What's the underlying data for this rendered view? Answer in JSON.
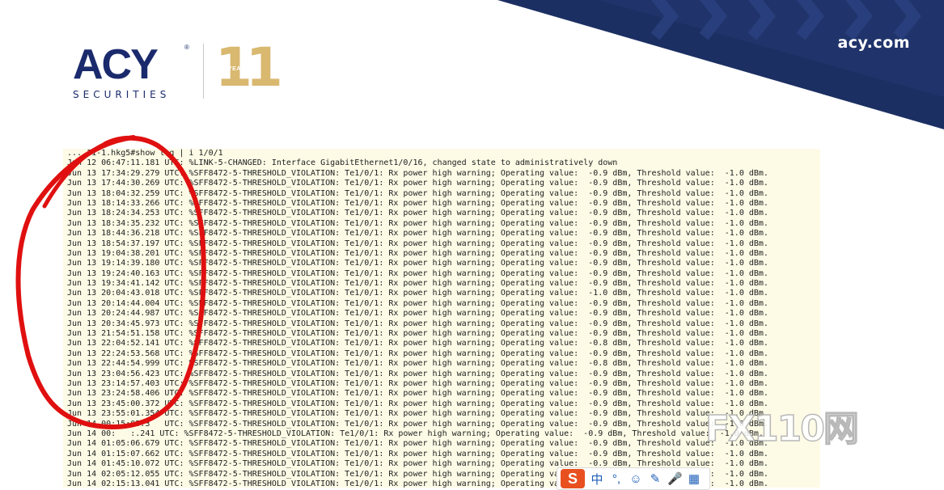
{
  "header": {
    "brand_url": "acy.com",
    "logo_text": "ACY",
    "logo_subtitle": "SECURITIES",
    "anniversary_number": "11",
    "anniversary_label": "YEARS",
    "colors": {
      "navy": "#1a2a6c",
      "gold": "#d9b870"
    }
  },
  "terminal": {
    "lines": [
      "... 11-1.hkg5#show log | i 1/0/1",
      "Jun 12 06:47:11.181 UTC: %LINK-5-CHANGED: Interface GigabitEthernet1/0/16, changed state to administratively down",
      "Jun 13 17:34:29.279 UTC: %SFF8472-5-THRESHOLD_VIOLATION: Te1/0/1: Rx power high warning; Operating value:  -0.9 dBm, Threshold value:  -1.0 dBm.",
      "Jun 13 17:44:30.269 UTC: %SFF8472-5-THRESHOLD_VIOLATION: Te1/0/1: Rx power high warning; Operating value:  -0.9 dBm, Threshold value:  -1.0 dBm.",
      "Jun 13 18:04:32.259 UTC: %SFF8472-5-THRESHOLD_VIOLATION: Te1/0/1: Rx power high warning; Operating value:  -0.9 dBm, Threshold value:  -1.0 dBm.",
      "Jun 13 18:14:33.266 UTC: %SFF8472-5-THRESHOLD_VIOLATION: Te1/0/1: Rx power high warning; Operating value:  -0.9 dBm, Threshold value:  -1.0 dBm.",
      "Jun 13 18:24:34.253 UTC: %SFF8472-5-THRESHOLD_VIOLATION: Te1/0/1: Rx power high warning; Operating value:  -0.9 dBm, Threshold value:  -1.0 dBm.",
      "Jun 13 18:34:35.232 UTC: %SFF8472-5-THRESHOLD_VIOLATION: Te1/0/1: Rx power high warning; Operating value:  -0.9 dBm, Threshold value:  -1.0 dBm.",
      "Jun 13 18:44:36.218 UTC: %SFF8472-5-THRESHOLD_VIOLATION: Te1/0/1: Rx power high warning; Operating value:  -0.9 dBm, Threshold value:  -1.0 dBm.",
      "Jun 13 18:54:37.197 UTC: %SFF8472-5-THRESHOLD_VIOLATION: Te1/0/1: Rx power high warning; Operating value:  -0.9 dBm, Threshold value:  -1.0 dBm.",
      "Jun 13 19:04:38.201 UTC: %SFF8472-5-THRESHOLD_VIOLATION: Te1/0/1: Rx power high warning; Operating value:  -0.9 dBm, Threshold value:  -1.0 dBm.",
      "Jun 13 19:14:39.180 UTC: %SFF8472-5-THRESHOLD_VIOLATION: Te1/0/1: Rx power high warning; Operating value:  -0.9 dBm, Threshold value:  -1.0 dBm.",
      "Jun 13 19:24:40.163 UTC: %SFF8472-5-THRESHOLD_VIOLATION: Te1/0/1: Rx power high warning; Operating value:  -0.9 dBm, Threshold value:  -1.0 dBm.",
      "Jun 13 19:34:41.142 UTC: %SFF8472-5-THRESHOLD_VIOLATION: Te1/0/1: Rx power high warning; Operating value:  -0.9 dBm, Threshold value:  -1.0 dBm.",
      "Jun 13 20:04:43.018 UTC: %SFF8472-5-THRESHOLD_VIOLATION: Te1/0/1: Rx power high warning; Operating value:  -1.0 dBm, Threshold value:  -1.0 dBm.",
      "Jun 13 20:14:44.004 UTC: %SFF8472-5-THRESHOLD_VIOLATION: Te1/0/1: Rx power high warning; Operating value:  -0.9 dBm, Threshold value:  -1.0 dBm.",
      "Jun 13 20:24:44.987 UTC: %SFF8472-5-THRESHOLD_VIOLATION: Te1/0/1: Rx power high warning; Operating value:  -0.9 dBm, Threshold value:  -1.0 dBm.",
      "Jun 13 20:34:45.973 UTC: %SFF8472-5-THRESHOLD_VIOLATION: Te1/0/1: Rx power high warning; Operating value:  -0.9 dBm, Threshold value:  -1.0 dBm.",
      "Jun 13 21:54:51.158 UTC: %SFF8472-5-THRESHOLD_VIOLATION: Te1/0/1: Rx power high warning; Operating value:  -0.9 dBm, Threshold value:  -1.0 dBm.",
      "Jun 13 22:04:52.141 UTC: %SFF8472-5-THRESHOLD_VIOLATION: Te1/0/1: Rx power high warning; Operating value:  -0.8 dBm, Threshold value:  -1.0 dBm.",
      "Jun 13 22:24:53.568 UTC: %SFF8472-5-THRESHOLD_VIOLATION: Te1/0/1: Rx power high warning; Operating value:  -0.9 dBm, Threshold value:  -1.0 dBm.",
      "Jun 13 22:44:54.999 UTC: %SFF8472-5-THRESHOLD_VIOLATION: Te1/0/1: Rx power high warning; Operating value:  -0.8 dBm, Threshold value:  -1.0 dBm.",
      "Jun 13 23:04:56.423 UTC: %SFF8472-5-THRESHOLD_VIOLATION: Te1/0/1: Rx power high warning; Operating value:  -0.9 dBm, Threshold value:  -1.0 dBm.",
      "Jun 13 23:14:57.403 UTC: %SFF8472-5-THRESHOLD_VIOLATION: Te1/0/1: Rx power high warning; Operating value:  -0.9 dBm, Threshold value:  -1.0 dBm.",
      "Jun 13 23:24:58.406 UTC: %SFF8472-5-THRESHOLD_VIOLATION: Te1/0/1: Rx power high warning; Operating value:  -0.9 dBm, Threshold value:  -1.0 dBm.",
      "Jun 13 23:45:00.372 UTC: %SFF8472-5-THRESHOLD_VIOLATION: Te1/0/1: Rx power high warning; Operating value:  -0.9 dBm, Threshold value:  -1.0 dBm.",
      "Jun 13 23:55:01.354 UTC: %SFF8472-5-THRESHOLD_VIOLATION: Te1/0/1: Rx power high warning; Operating value:  -0.9 dBm, Threshold value:  -1.0 dBm.",
      "Jun 14 00:15:03.3   UTC: %SFF8472-5-THRESHOLD_VIOLATION: Te1/0/1: Rx power high warning; Operating value:  -0.9 dBm, Threshold value:  -1.0 dBm.",
      "Jun 14 00:   :.241 UTC: %SFF8472-5-THRESHOLD_VIOLATION: Te1/0/1: Rx power high warning; Operating value:  -0.9 dBm, Threshold value:  -1.0 dBm.",
      "Jun 14 01:05:06.679 UTC: %SFF8472-5-THRESHOLD_VIOLATION: Te1/0/1: Rx power high warning; Operating value:  -0.9 dBm, Threshold value:  -1.0 dBm.",
      "Jun 14 01:15:07.662 UTC: %SFF8472-5-THRESHOLD_VIOLATION: Te1/0/1: Rx power high warning; Operating value:  -0.9 dBm, Threshold value:  -1.0 dBm.",
      "Jun 14 01:45:10.072 UTC: %SFF8472-5-THRESHOLD_VIOLATION: Te1/0/1: Rx power high warning; Operating value:  -0.9 dBm, Threshold value:  -1.0 dBm.",
      "Jun 14 02:05:12.055 UTC: %SFF8472-5-THRESHOLD_VIOLATION: Te1/0/1: Rx power high warning; Operating value:  -0.9 dBm, Threshold value:  -1.0 dBm.",
      "Jun 14 02:15:13.041 UTC: %SFF8472-5-THRESHOLD_VIOLATION: Te1/0/1: Rx power high warning; Operating value:  -0.9 dBm, Threshold value:  -1.0 dBm."
    ]
  },
  "watermark": {
    "text": "FX110网"
  },
  "ime_toolbar": {
    "logo": "S",
    "items": [
      "中",
      "°,",
      "☺",
      "✎",
      "🎤",
      "▦"
    ]
  },
  "annotation": {
    "color": "#e01010"
  }
}
